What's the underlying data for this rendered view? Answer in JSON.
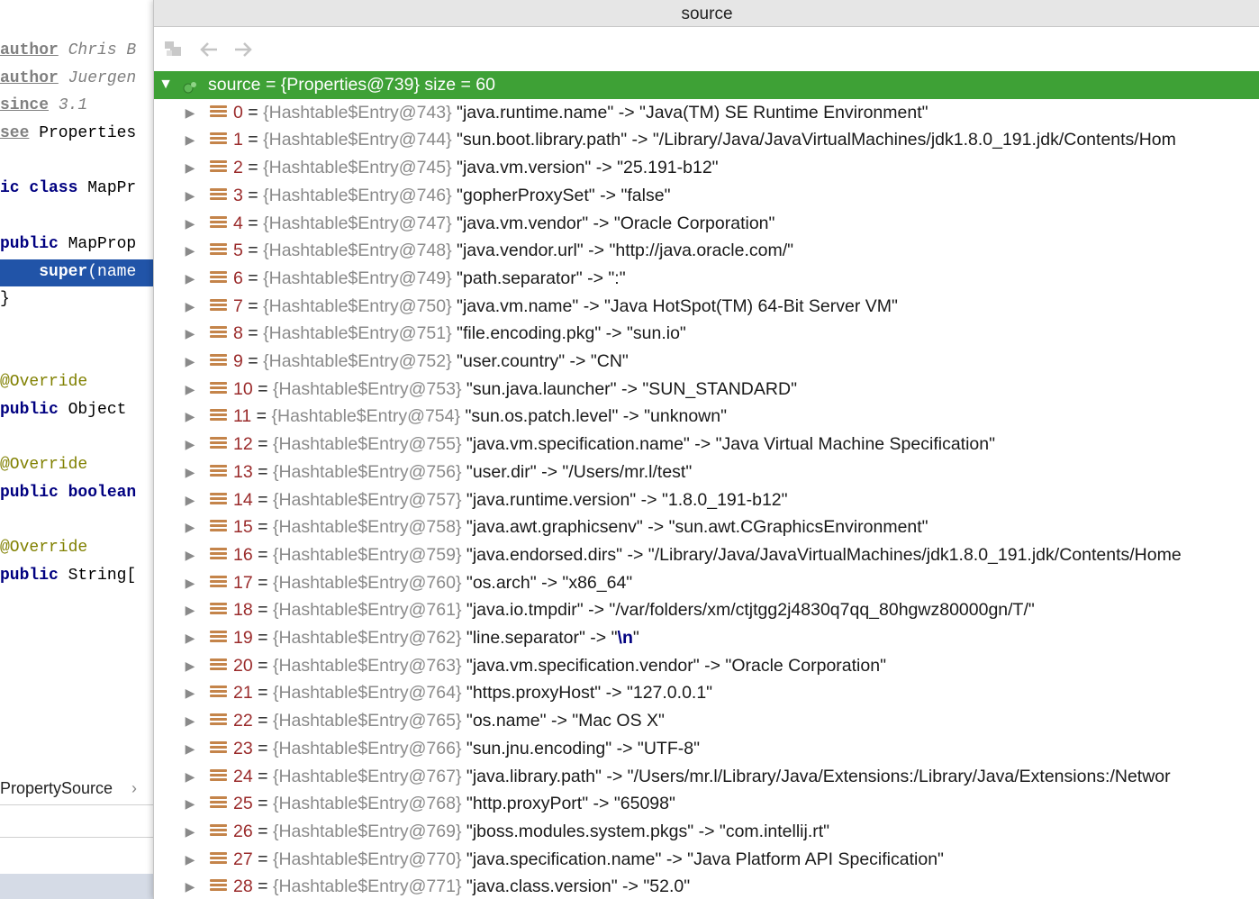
{
  "editor": {
    "lines": [
      {
        "parts": [
          {
            "cls": "doc-tag",
            "text": "author"
          },
          {
            "cls": "doc-text",
            "text": " Chris B"
          }
        ]
      },
      {
        "parts": [
          {
            "cls": "doc-tag",
            "text": "author"
          },
          {
            "cls": "doc-text",
            "text": " Juergen"
          }
        ]
      },
      {
        "parts": [
          {
            "cls": "doc-tag",
            "text": "since"
          },
          {
            "cls": "doc-text",
            "text": " 3.1"
          }
        ]
      },
      {
        "parts": [
          {
            "cls": "doc-tag",
            "text": "see"
          },
          {
            "cls": "",
            "text": " Properties"
          }
        ]
      },
      {
        "parts": []
      },
      {
        "parts": [
          {
            "cls": "kw",
            "text": "ic class"
          },
          {
            "cls": "",
            "text": " MapPr"
          }
        ]
      },
      {
        "parts": []
      },
      {
        "parts": [
          {
            "cls": "kw",
            "text": "public"
          },
          {
            "cls": "",
            "text": " MapProp"
          }
        ]
      },
      {
        "parts": [
          {
            "cls": "",
            "text": "    "
          },
          {
            "cls": "kw",
            "text": "super"
          },
          {
            "cls": "",
            "text": "(name"
          }
        ]
      },
      {
        "parts": [
          {
            "cls": "",
            "text": "}"
          }
        ]
      },
      {
        "parts": []
      },
      {
        "parts": []
      },
      {
        "parts": [
          {
            "cls": "anno",
            "text": "@Override"
          }
        ]
      },
      {
        "parts": [
          {
            "cls": "kw",
            "text": "public"
          },
          {
            "cls": "",
            "text": " Object"
          }
        ]
      },
      {
        "parts": []
      },
      {
        "parts": [
          {
            "cls": "anno",
            "text": "@Override"
          }
        ]
      },
      {
        "parts": [
          {
            "cls": "kw",
            "text": "public boolean"
          }
        ]
      },
      {
        "parts": []
      },
      {
        "parts": [
          {
            "cls": "anno",
            "text": "@Override"
          }
        ]
      },
      {
        "parts": [
          {
            "cls": "kw",
            "text": "public"
          },
          {
            "cls": "",
            "text": " String["
          }
        ]
      }
    ],
    "breadcrumb": "PropertySource",
    "breadcrumb_sep": "›"
  },
  "popup": {
    "title": "source",
    "toolbar": {
      "icons": [
        "navigate-icon",
        "back-icon",
        "forward-icon"
      ]
    },
    "root": {
      "label": "source = {Properties@739}  size = 60"
    },
    "entries": [
      {
        "index": "0",
        "ref": "{Hashtable$Entry@743}",
        "key": "\"java.runtime.name\"",
        "value": "\"Java(TM) SE Runtime Environment\""
      },
      {
        "index": "1",
        "ref": "{Hashtable$Entry@744}",
        "key": "\"sun.boot.library.path\"",
        "value": "\"/Library/Java/JavaVirtualMachines/jdk1.8.0_191.jdk/Contents/Hom"
      },
      {
        "index": "2",
        "ref": "{Hashtable$Entry@745}",
        "key": "\"java.vm.version\"",
        "value": "\"25.191-b12\""
      },
      {
        "index": "3",
        "ref": "{Hashtable$Entry@746}",
        "key": "\"gopherProxySet\"",
        "value": "\"false\""
      },
      {
        "index": "4",
        "ref": "{Hashtable$Entry@747}",
        "key": "\"java.vm.vendor\"",
        "value": "\"Oracle Corporation\""
      },
      {
        "index": "5",
        "ref": "{Hashtable$Entry@748}",
        "key": "\"java.vendor.url\"",
        "value": "\"http://java.oracle.com/\""
      },
      {
        "index": "6",
        "ref": "{Hashtable$Entry@749}",
        "key": "\"path.separator\"",
        "value": "\":\""
      },
      {
        "index": "7",
        "ref": "{Hashtable$Entry@750}",
        "key": "\"java.vm.name\"",
        "value": "\"Java HotSpot(TM) 64-Bit Server VM\""
      },
      {
        "index": "8",
        "ref": "{Hashtable$Entry@751}",
        "key": "\"file.encoding.pkg\"",
        "value": "\"sun.io\""
      },
      {
        "index": "9",
        "ref": "{Hashtable$Entry@752}",
        "key": "\"user.country\"",
        "value": "\"CN\""
      },
      {
        "index": "10",
        "ref": "{Hashtable$Entry@753}",
        "key": "\"sun.java.launcher\"",
        "value": "\"SUN_STANDARD\""
      },
      {
        "index": "11",
        "ref": "{Hashtable$Entry@754}",
        "key": "\"sun.os.patch.level\"",
        "value": "\"unknown\""
      },
      {
        "index": "12",
        "ref": "{Hashtable$Entry@755}",
        "key": "\"java.vm.specification.name\"",
        "value": "\"Java Virtual Machine Specification\""
      },
      {
        "index": "13",
        "ref": "{Hashtable$Entry@756}",
        "key": "\"user.dir\"",
        "value": "\"/Users/mr.l/test\""
      },
      {
        "index": "14",
        "ref": "{Hashtable$Entry@757}",
        "key": "\"java.runtime.version\"",
        "value": "\"1.8.0_191-b12\""
      },
      {
        "index": "15",
        "ref": "{Hashtable$Entry@758}",
        "key": "\"java.awt.graphicsenv\"",
        "value": "\"sun.awt.CGraphicsEnvironment\""
      },
      {
        "index": "16",
        "ref": "{Hashtable$Entry@759}",
        "key": "\"java.endorsed.dirs\"",
        "value": "\"/Library/Java/JavaVirtualMachines/jdk1.8.0_191.jdk/Contents/Home"
      },
      {
        "index": "17",
        "ref": "{Hashtable$Entry@760}",
        "key": "\"os.arch\"",
        "value": "\"x86_64\""
      },
      {
        "index": "18",
        "ref": "{Hashtable$Entry@761}",
        "key": "\"java.io.tmpdir\"",
        "value": "\"/var/folders/xm/ctjtgg2j4830q7qq_80hgwz80000gn/T/\""
      },
      {
        "index": "19",
        "ref": "{Hashtable$Entry@762}",
        "key": "\"line.separator\"",
        "value_pre": "\"",
        "value_esc": "\\n",
        "value_post": "\""
      },
      {
        "index": "20",
        "ref": "{Hashtable$Entry@763}",
        "key": "\"java.vm.specification.vendor\"",
        "value": "\"Oracle Corporation\""
      },
      {
        "index": "21",
        "ref": "{Hashtable$Entry@764}",
        "key": "\"https.proxyHost\"",
        "value": "\"127.0.0.1\""
      },
      {
        "index": "22",
        "ref": "{Hashtable$Entry@765}",
        "key": "\"os.name\"",
        "value": "\"Mac OS X\""
      },
      {
        "index": "23",
        "ref": "{Hashtable$Entry@766}",
        "key": "\"sun.jnu.encoding\"",
        "value": "\"UTF-8\""
      },
      {
        "index": "24",
        "ref": "{Hashtable$Entry@767}",
        "key": "\"java.library.path\"",
        "value": "\"/Users/mr.l/Library/Java/Extensions:/Library/Java/Extensions:/Networ"
      },
      {
        "index": "25",
        "ref": "{Hashtable$Entry@768}",
        "key": "\"http.proxyPort\"",
        "value": "\"65098\""
      },
      {
        "index": "26",
        "ref": "{Hashtable$Entry@769}",
        "key": "\"jboss.modules.system.pkgs\"",
        "value": "\"com.intellij.rt\""
      },
      {
        "index": "27",
        "ref": "{Hashtable$Entry@770}",
        "key": "\"java.specification.name\"",
        "value": "\"Java Platform API Specification\""
      },
      {
        "index": "28",
        "ref": "{Hashtable$Entry@771}",
        "key": "\"java.class.version\"",
        "value": "\"52.0\""
      }
    ],
    "arrow_collapsed": "▶",
    "arrow_expanded": "▼",
    "eq": " = ",
    "sep": " -> "
  },
  "colors": {
    "root_row": "#3ea136",
    "exec_line": "#2154a8",
    "index": "#9a2b2b",
    "ref": "#8a8a8a",
    "entry_icon": "#c4844a"
  }
}
